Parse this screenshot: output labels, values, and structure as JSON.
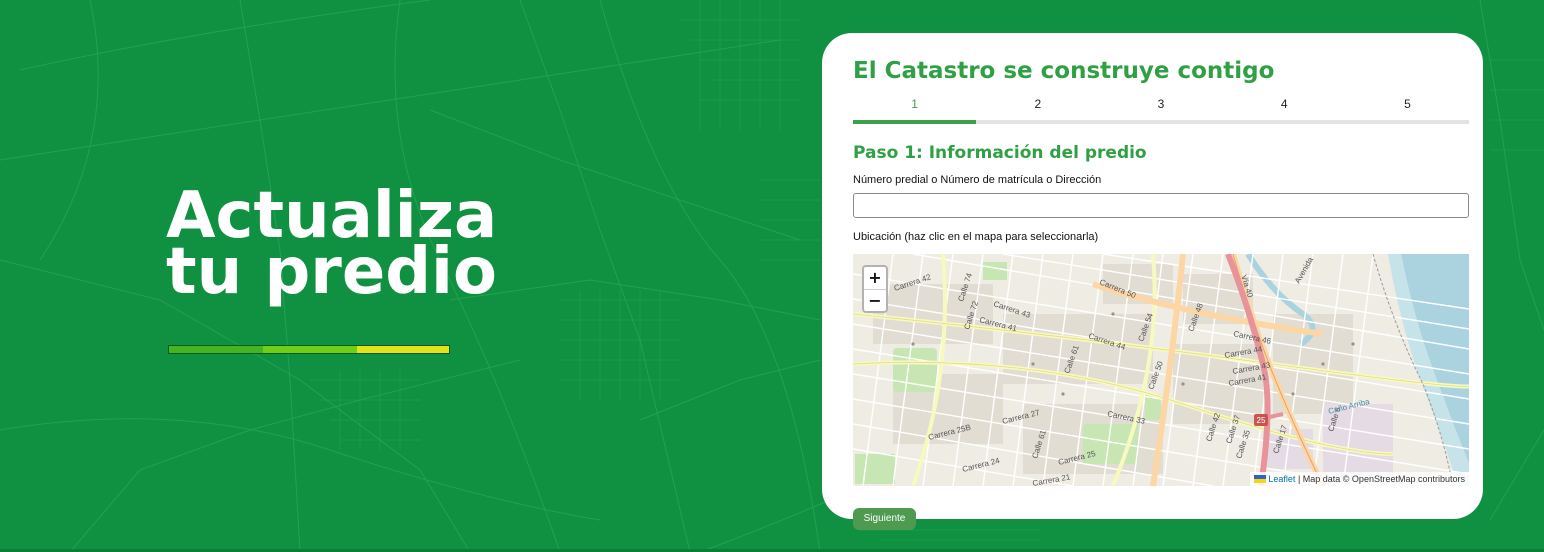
{
  "hero": {
    "title_line1": "Actualiza",
    "title_line2": "tu predio",
    "accent_colors": [
      "#46b322",
      "#6fcf16",
      "#e2e31b"
    ]
  },
  "colors": {
    "background": "#0f9141",
    "brand_green": "#2fa043",
    "card": "#ffffff"
  },
  "form": {
    "title": "El Catastro se construye contigo",
    "steps": [
      "1",
      "2",
      "3",
      "4",
      "5"
    ],
    "current_step": 1,
    "total_steps": 5,
    "section_title": "Paso 1: Información del predio",
    "predio_label": "Número predial o Número de matrícula o Dirección",
    "predio_value": "",
    "predio_placeholder": "",
    "map_label": "Ubicación (haz clic en el mapa para seleccionarla)",
    "next_label": "Siguiente"
  },
  "map": {
    "zoom_in_label": "+",
    "zoom_out_label": "−",
    "attribution_link": "Leaflet",
    "attribution_text": " | Map data © OpenStreetMap contributors",
    "street_labels": [
      "Carrera 42",
      "Carrera 43",
      "Calle 74",
      "Carrera 50",
      "Calle 72",
      "Carrera 44",
      "Carrera 41",
      "Calle 54",
      "Calle 48",
      "Carrera 46",
      "Carrera 44",
      "Calle 61",
      "Carrera 43",
      "Carrera 41",
      "Calle 50",
      "Carrera 33",
      "Carrera 27",
      "Calle 42",
      "Calle 37",
      "Calle 35",
      "Carrera 25B",
      "Calle 61",
      "Carrera 25",
      "Carrera 24",
      "Carrera 21",
      "Calle 17",
      "Calle 6",
      "Caño Arriba",
      "25",
      "Vía 40",
      "Avenida"
    ]
  }
}
